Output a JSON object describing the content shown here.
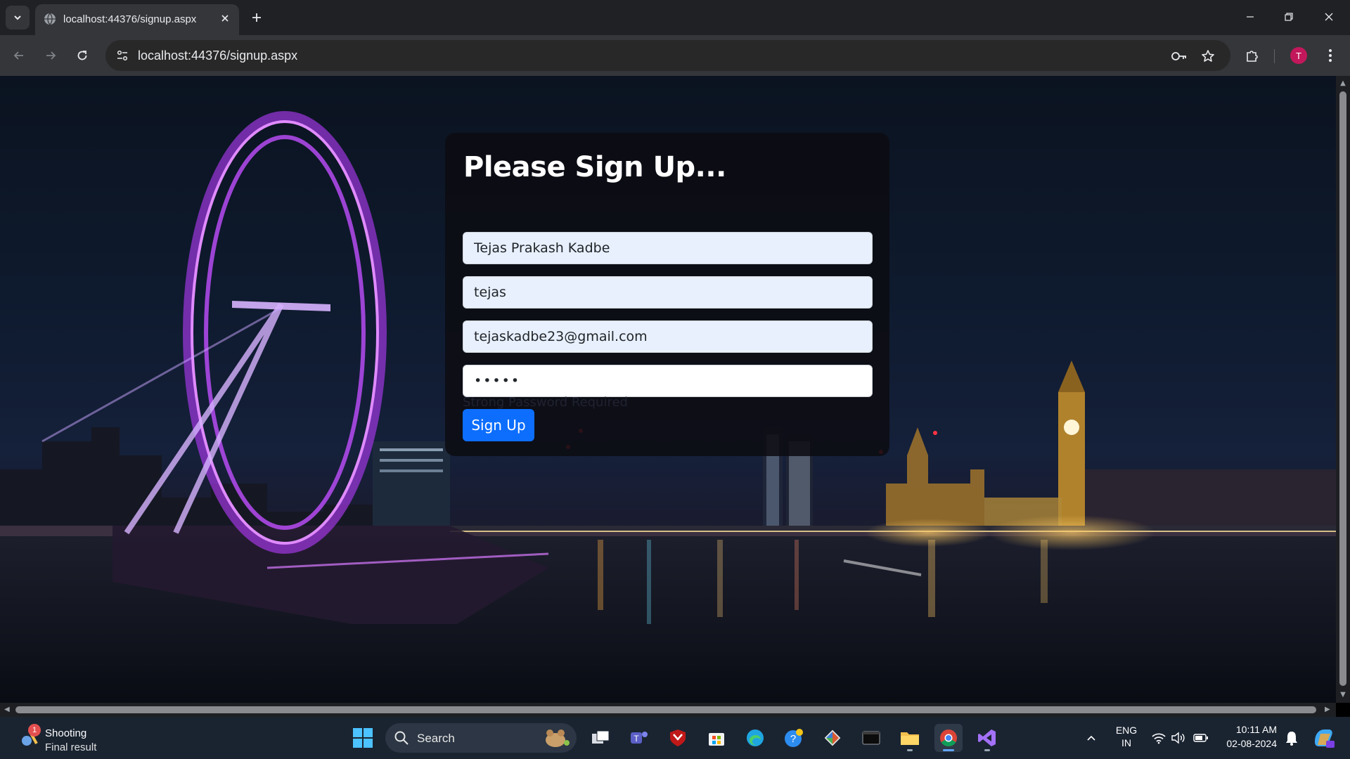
{
  "browser": {
    "tab_title": "localhost:44376/signup.aspx",
    "url": "localhost:44376/signup.aspx",
    "profile_initial": "T"
  },
  "form": {
    "heading": "Please Sign Up...",
    "name_value": "Tejas Prakash Kadbe",
    "username_value": "tejas",
    "email_value": "tejaskadbe23@gmail.com",
    "password_value": "•••••",
    "password_hint": "Strong Password Required",
    "submit_label": "Sign Up"
  },
  "colors": {
    "primary_button": "#0d6efd",
    "autofill_bg": "#e8f0fe",
    "card_bg": "#0c0c12",
    "eye_ring": "#c040ff"
  },
  "taskbar": {
    "widget_badge": "1",
    "widget_title": "Shooting",
    "widget_subtitle": "Final result",
    "search_label": "Search",
    "lang_top": "ENG",
    "lang_bottom": "IN",
    "time": "10:11 AM",
    "date": "02-08-2024"
  }
}
